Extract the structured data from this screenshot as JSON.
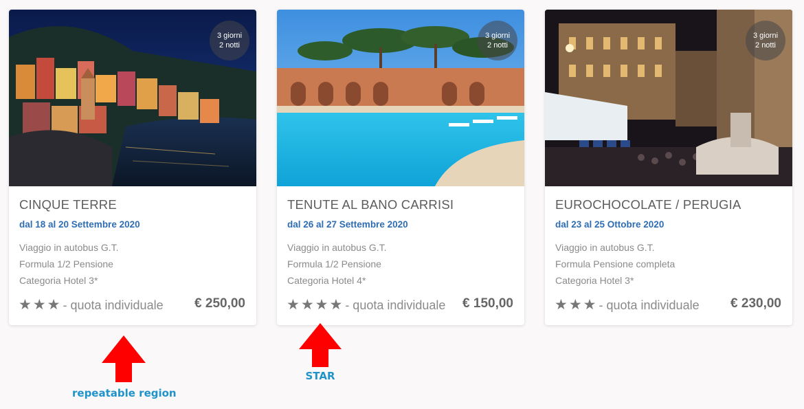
{
  "cards": [
    {
      "image": "cinque-terre-photo",
      "badge": {
        "days": "3 giorni",
        "nights": "2 notti"
      },
      "title": "CINQUE TERRE",
      "dates": "dal 18 al 20 Settembre 2020",
      "features": [
        "Viaggio in autobus G.T.",
        "Formula 1/2 Pensione",
        "Categoria Hotel 3*"
      ],
      "stars": 3,
      "star_glyph": "★",
      "rating_label": "- quota individuale",
      "price": "€ 250,00"
    },
    {
      "image": "tenute-al-bano-pool-photo",
      "badge": {
        "days": "3 giorni",
        "nights": "2 notti"
      },
      "title": "TENUTE AL BANO CARRISI",
      "dates": "dal 26 al 27 Settembre 2020",
      "features": [
        "Viaggio in autobus G.T.",
        "Formula 1/2 Pensione",
        "Categoria Hotel 4*"
      ],
      "stars": 4,
      "star_glyph": "★",
      "rating_label": "- quota individuale",
      "price": "€ 150,00"
    },
    {
      "image": "perugia-night-square-photo",
      "badge": {
        "days": "3 giorni",
        "nights": "2 notti"
      },
      "title": "EUROCHOCOLATE / PERUGIA",
      "dates": "dal 23 al 25 Ottobre 2020",
      "features": [
        "Viaggio in autobus G.T.",
        "Formula Pensione completa",
        "Categoria Hotel 3*"
      ],
      "stars": 3,
      "star_glyph": "★",
      "rating_label": "- quota individuale",
      "price": "€ 230,00"
    }
  ],
  "annotations": [
    {
      "label": "repeatable region",
      "icon": "red-arrow-up-icon"
    },
    {
      "label": "STAR",
      "icon": "red-arrow-up-icon"
    }
  ],
  "colors": {
    "page_background": "#faf8f8",
    "title": "#5d5d5d",
    "dates": "#2e6db3",
    "feature_text": "#8a8a8a",
    "stars": "#777777",
    "price": "#666666",
    "annotation_arrow": "#ff0000",
    "annotation_label": "#1f93c9"
  }
}
